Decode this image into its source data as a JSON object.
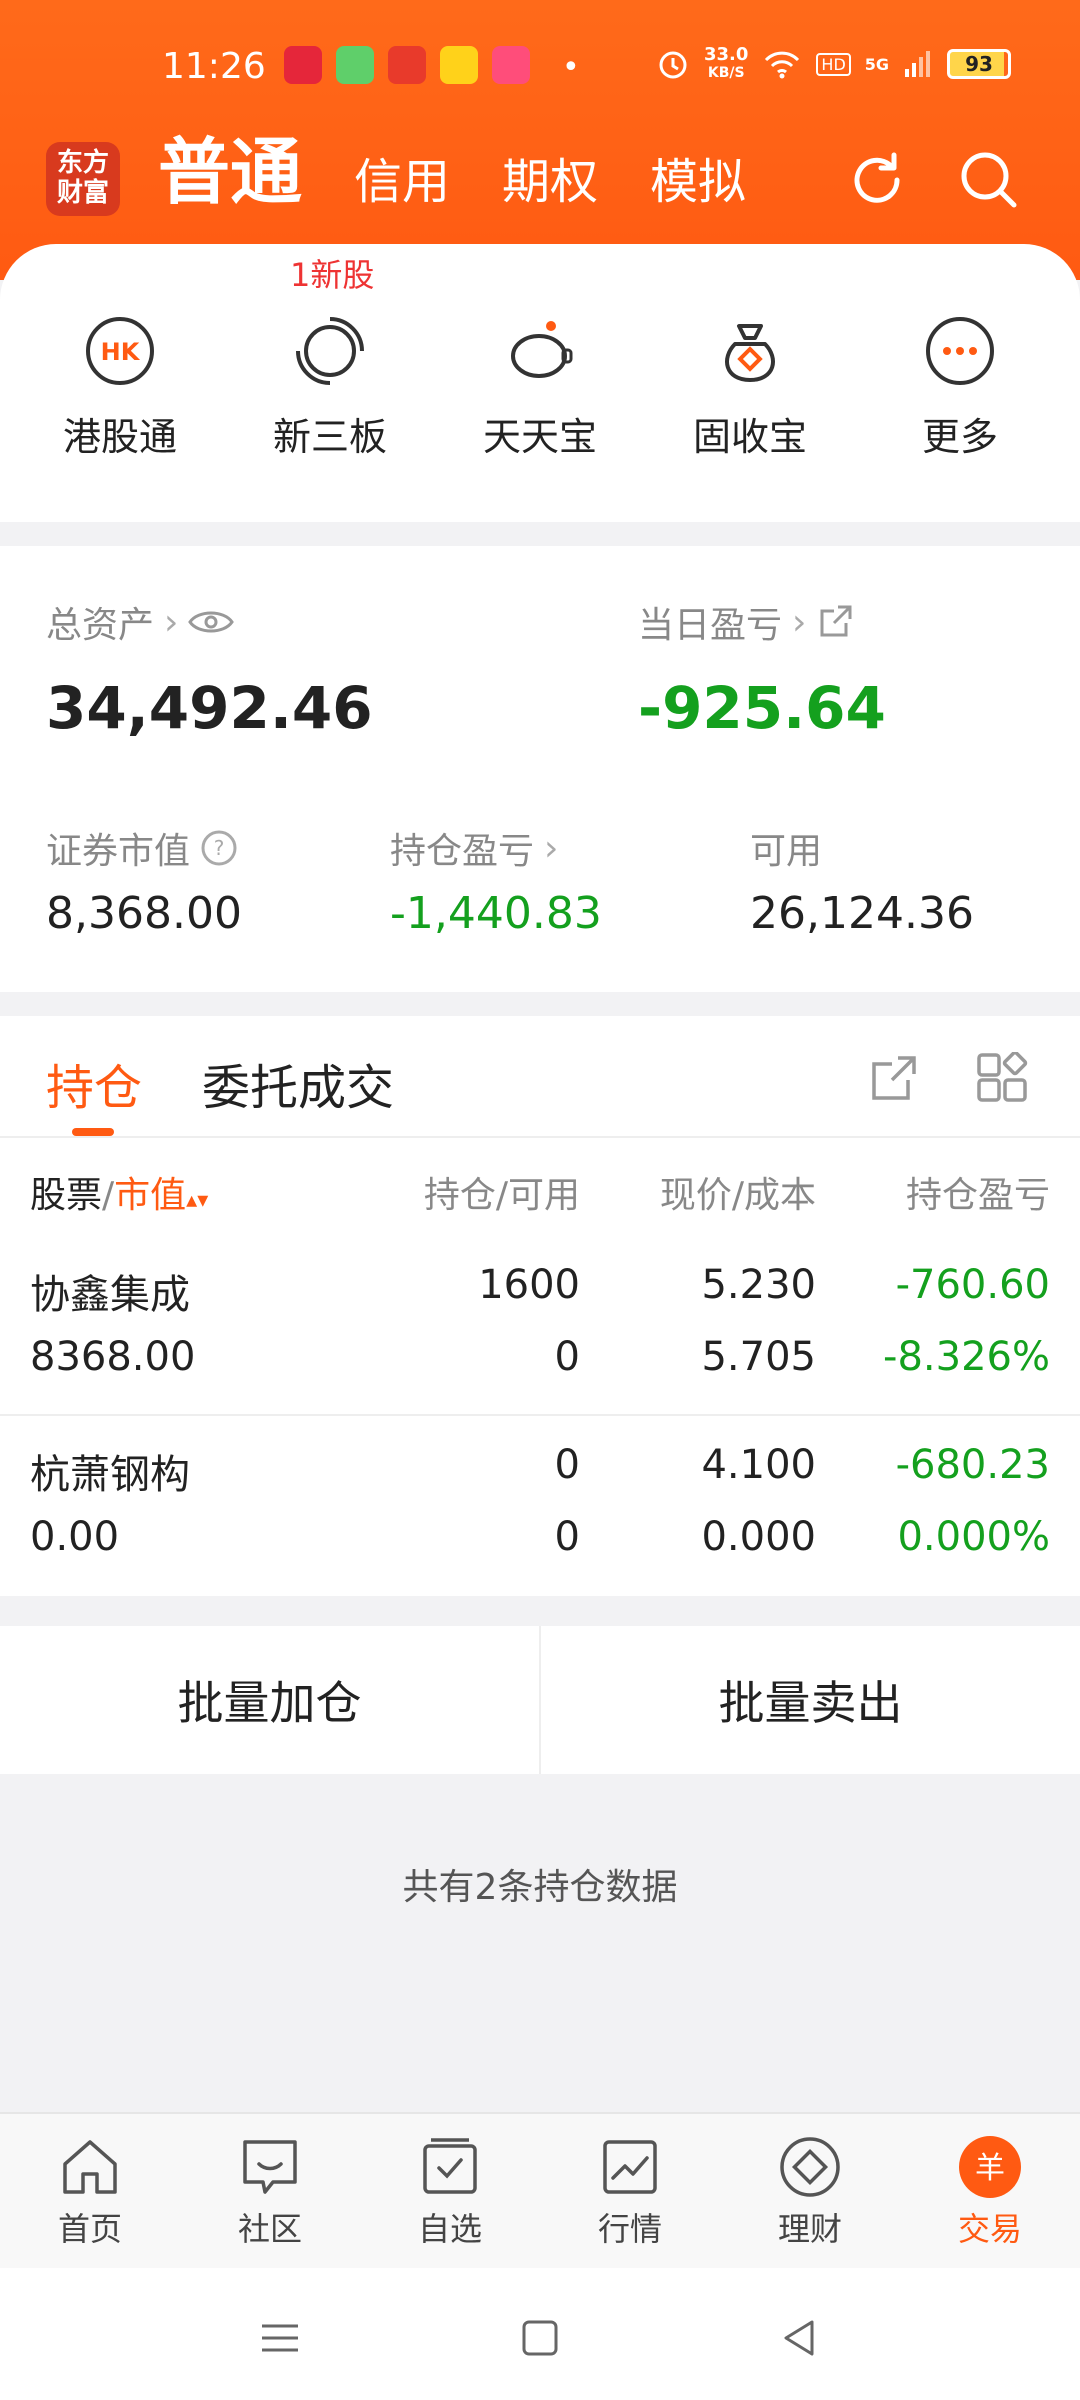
{
  "status_bar": {
    "time": "11:26",
    "net_speed_value": "33.0",
    "net_speed_unit": "KB/S",
    "hd": "HD",
    "signal": "5G",
    "battery": "93"
  },
  "header": {
    "logo_line1": "东方",
    "logo_line2": "财富",
    "tabs": [
      "普通",
      "信用",
      "期权",
      "模拟"
    ],
    "active_tab": "普通"
  },
  "quick_menu": {
    "new_stock_tag": "1新股",
    "items": [
      {
        "label": "港股通",
        "icon": "hk-icon"
      },
      {
        "label": "新三板",
        "icon": "new-board-icon"
      },
      {
        "label": "天天宝",
        "icon": "piggy-bank-icon"
      },
      {
        "label": "固收宝",
        "icon": "money-bag-icon"
      },
      {
        "label": "更多",
        "icon": "more-icon"
      }
    ]
  },
  "assets": {
    "total_label": "总资产",
    "total_value": "34,492.46",
    "daily_pnl_label": "当日盈亏",
    "daily_pnl_value": "-925.64",
    "market_value_label": "证券市值",
    "market_value": "8,368.00",
    "holding_pnl_label": "持仓盈亏",
    "holding_pnl_value": "-1,440.83",
    "available_label": "可用",
    "available_value": "26,124.36"
  },
  "positions": {
    "tabs": [
      "持仓",
      "委托成交"
    ],
    "active_tab": "持仓",
    "columns": {
      "stock": "股票",
      "slash": "/",
      "market_value": "市值",
      "holding": "持仓/可用",
      "price": "现价/成本",
      "pnl": "持仓盈亏"
    },
    "rows": [
      {
        "name": "协鑫集成",
        "market_value": "8368.00",
        "holding": "1600",
        "available": "0",
        "price": "5.230",
        "cost": "5.705",
        "pnl": "-760.60",
        "pnl_pct": "-8.326%"
      },
      {
        "name": "杭萧钢构",
        "market_value": "0.00",
        "holding": "0",
        "available": "0",
        "price": "4.100",
        "cost": "0.000",
        "pnl": "-680.23",
        "pnl_pct": "0.000%"
      }
    ]
  },
  "batch": {
    "add_label": "批量加仓",
    "sell_label": "批量卖出"
  },
  "summary_text": "共有2条持仓数据",
  "bottom_nav": {
    "items": [
      {
        "label": "首页",
        "icon": "home-icon"
      },
      {
        "label": "社区",
        "icon": "community-icon"
      },
      {
        "label": "自选",
        "icon": "watchlist-icon"
      },
      {
        "label": "行情",
        "icon": "market-icon"
      },
      {
        "label": "理财",
        "icon": "wealth-icon"
      },
      {
        "label": "交易",
        "icon": "trade-icon"
      }
    ],
    "active": "交易",
    "trade_glyph": "羊"
  },
  "colors": {
    "brand": "#ff5a12",
    "loss_green": "#14a01e",
    "new_stock_red": "#e33333"
  }
}
